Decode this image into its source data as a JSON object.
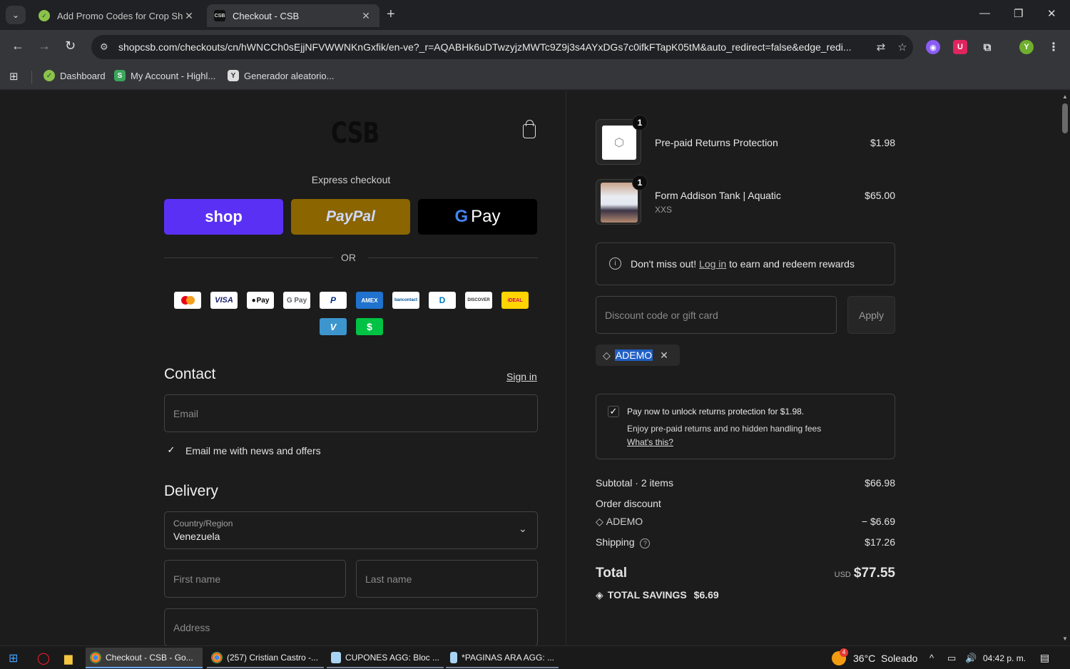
{
  "browser": {
    "tabs": [
      {
        "title": "Add Promo Codes for Crop Sho",
        "active": false
      },
      {
        "title": "Checkout - CSB",
        "active": true
      }
    ],
    "url": "shopcsb.com/checkouts/cn/hWNCCh0sEjjNFVWWNKnGxfik/en-ve?_r=AQABHk6uDTwzyjzMWTc9Z9j3s4AYxDGs7c0ifkFTapK05tM&auto_redirect=false&edge_redi...",
    "profile_initial": "Y",
    "bookmarks": [
      {
        "label": "Dashboard"
      },
      {
        "label": "My Account - Highl..."
      },
      {
        "label": "Generador aleatorio..."
      }
    ]
  },
  "checkout": {
    "logo": "CSB",
    "express_label": "Express checkout",
    "shop_pay_label": "shop",
    "paypal_label": "PayPal",
    "gpay_label": "Pay",
    "or_label": "OR",
    "payment_methods": [
      "mastercard",
      "VISA",
      "Pay",
      "G Pay",
      "P",
      "AMEX",
      "bancontact",
      "D",
      "DISCOVER",
      "iDEAL",
      "V",
      "$"
    ],
    "contact": {
      "heading": "Contact",
      "sign_in": "Sign in",
      "email_placeholder": "Email",
      "newsletter_label": "Email me with news and offers"
    },
    "delivery": {
      "heading": "Delivery",
      "country_label": "Country/Region",
      "country_value": "Venezuela",
      "first_name_placeholder": "First name",
      "last_name_placeholder": "Last name",
      "address_placeholder": "Address"
    }
  },
  "summary": {
    "items": [
      {
        "qty": "1",
        "title": "Pre-paid Returns Protection",
        "variant": "",
        "price": "$1.98"
      },
      {
        "qty": "1",
        "title": "Form Addison Tank | Aquatic",
        "variant": "XXS",
        "price": "$65.00"
      }
    ],
    "rewards": {
      "pre": "Don't miss out!",
      "link": "Log in",
      "post": "to earn and redeem rewards"
    },
    "discount_placeholder": "Discount code or gift card",
    "apply_label": "Apply",
    "applied_code": "ADEMO",
    "protection": {
      "title": "Pay now to unlock returns protection for $1.98.",
      "desc": "Enjoy pre-paid returns and no hidden handling fees",
      "link": "What's this?"
    },
    "subtotal_label": "Subtotal · 2 items",
    "subtotal_value": "$66.98",
    "order_discount_label": "Order discount",
    "discount_code": "ADEMO",
    "discount_value": "− $6.69",
    "shipping_label": "Shipping",
    "shipping_value": "$17.26",
    "total_label": "Total",
    "currency": "USD",
    "total_value": "$77.55",
    "savings_label": "TOTAL SAVINGS",
    "savings_value": "$6.69"
  },
  "taskbar": {
    "items": [
      {
        "label": "Checkout - CSB - Go..."
      },
      {
        "label": "(257) Cristian Castro -..."
      },
      {
        "label": "CUPONES AGG: Bloc ..."
      },
      {
        "label": "*PAGINAS ARA AGG: ..."
      }
    ],
    "weather_badge": "4",
    "weather": "36°C  Soleado",
    "time": "04:42 p. m."
  }
}
